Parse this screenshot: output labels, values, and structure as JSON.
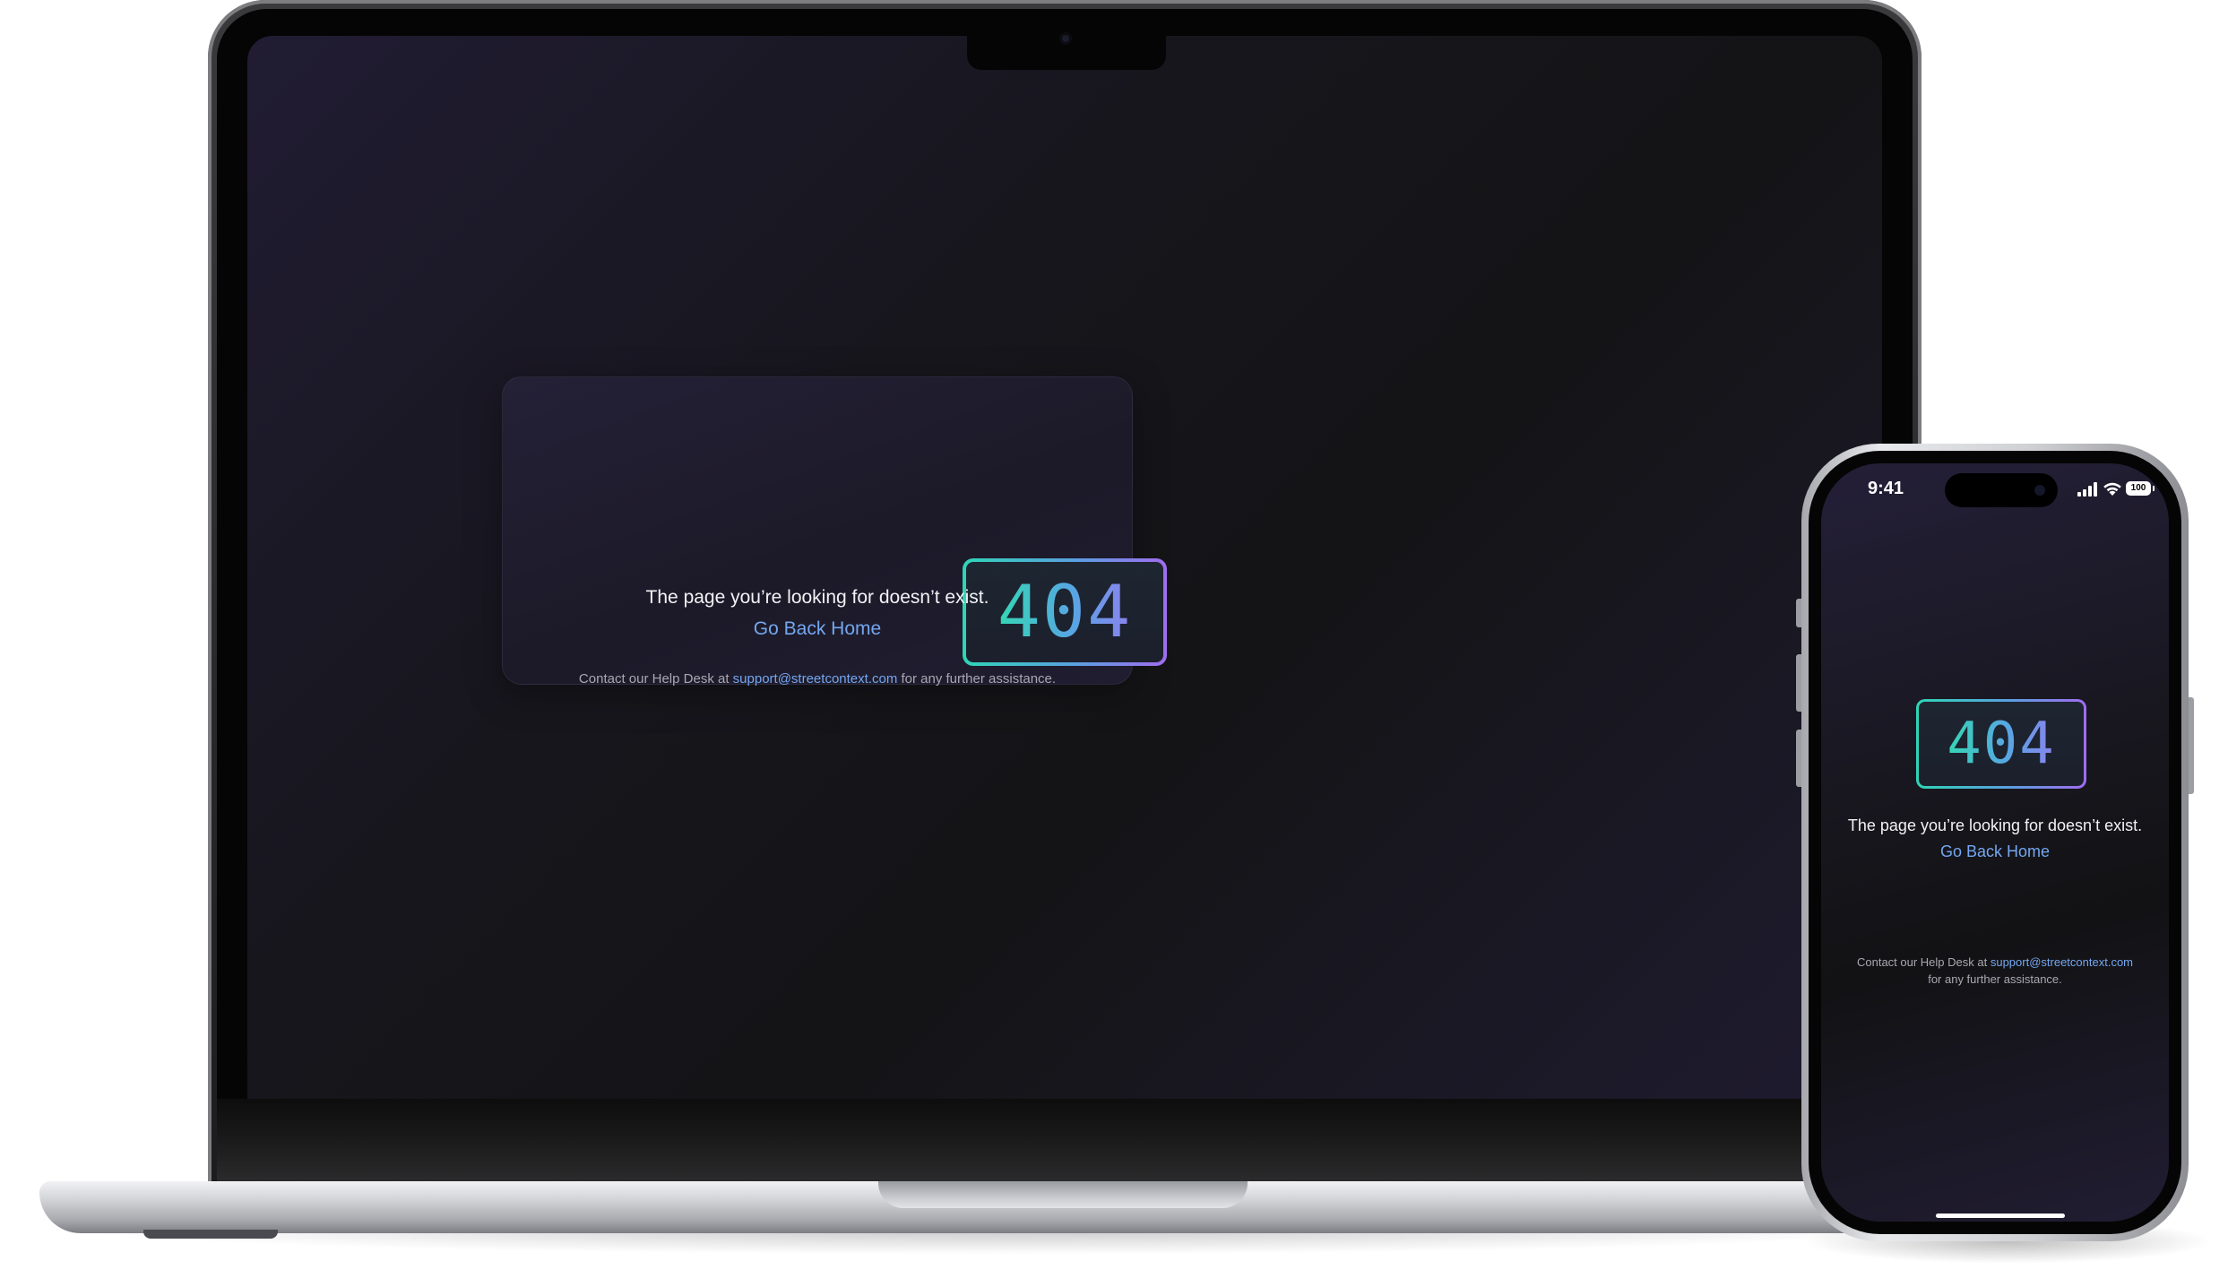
{
  "error_page": {
    "code": "404",
    "message": "The page you’re looking for doesn’t exist.",
    "home_link": "Go Back Home",
    "contact_prefix": "Contact our Help Desk at",
    "contact_email": "support@streetcontext.com",
    "contact_suffix": "for any further assistance."
  },
  "phone_status": {
    "time": "9:41",
    "battery": "100",
    "icons": [
      "cellular-signal-icon",
      "wifi-icon",
      "battery-icon"
    ]
  },
  "colors": {
    "accent_link": "#74a7f0",
    "gradient_start": "#2fd5b6",
    "gradient_end": "#a06cf0",
    "background": "#141416"
  }
}
